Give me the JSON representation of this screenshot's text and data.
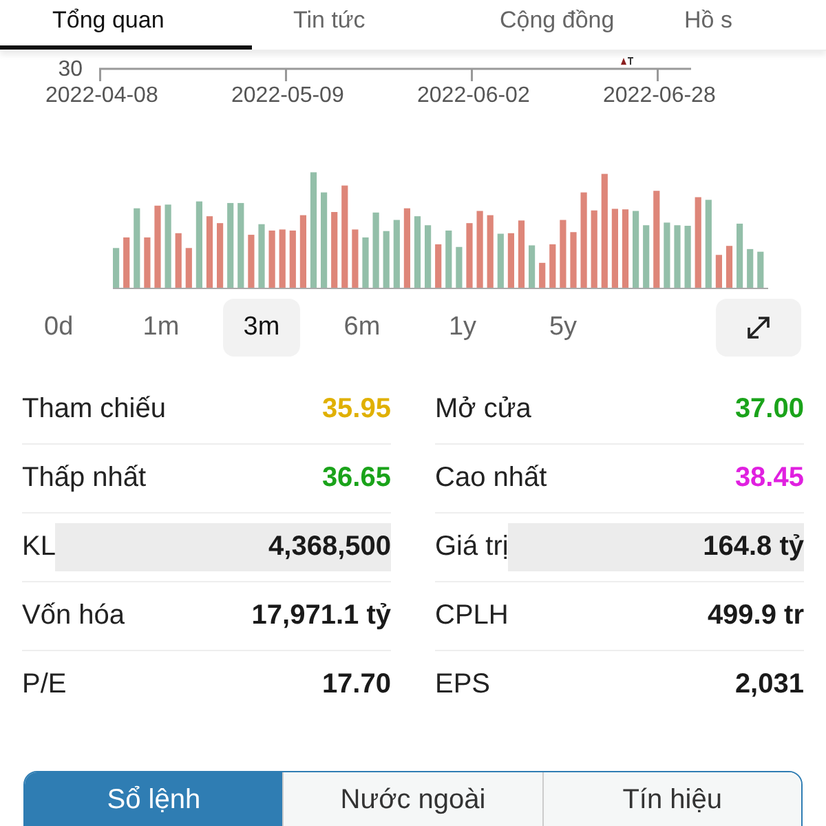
{
  "top_tabs": [
    {
      "label": "Tổng quan",
      "selected": true
    },
    {
      "label": "Tin tức",
      "selected": false
    },
    {
      "label": "Cộng đồng",
      "selected": false
    },
    {
      "label": "Hồ s",
      "selected": false
    }
  ],
  "price_axis": {
    "y_tick": "30",
    "dates": [
      "2022-04-08",
      "2022-05-09",
      "2022-06-02",
      "2022-06-28"
    ]
  },
  "volume_chart": {
    "kind": "picture"
  },
  "periods": [
    {
      "label": "0d",
      "selected": false
    },
    {
      "label": "1m",
      "selected": false
    },
    {
      "label": "3m",
      "selected": true
    },
    {
      "label": "6m",
      "selected": false
    },
    {
      "label": "1y",
      "selected": false
    },
    {
      "label": "5y",
      "selected": false
    }
  ],
  "stats": [
    [
      {
        "label": "Tham chiếu",
        "value": "35.95",
        "color": "#e0b000",
        "highlighted": false
      },
      {
        "label": "Mở cửa",
        "value": "37.00",
        "color": "#1aa31a",
        "highlighted": false
      }
    ],
    [
      {
        "label": "Thấp nhất",
        "value": "36.65",
        "color": "#1aa31a",
        "highlighted": false
      },
      {
        "label": "Cao nhất",
        "value": "38.45",
        "color": "#e020e0",
        "highlighted": false
      }
    ],
    [
      {
        "label": "KL",
        "value": "4,368,500",
        "color": "#1a1a1a",
        "highlighted": true
      },
      {
        "label": "Giá trị",
        "value": "164.8 tỷ",
        "color": "#1a1a1a",
        "highlighted": true
      }
    ],
    [
      {
        "label": "Vốn hóa",
        "value": "17,971.1 tỷ",
        "color": "#1a1a1a",
        "highlighted": false
      },
      {
        "label": "CPLH",
        "value": "499.9 tr",
        "color": "#1a1a1a",
        "highlighted": false
      }
    ],
    [
      {
        "label": "P/E",
        "value": "17.70",
        "color": "#1a1a1a",
        "highlighted": false
      },
      {
        "label": "EPS",
        "value": "2,031",
        "color": "#1a1a1a",
        "highlighted": false
      }
    ]
  ],
  "bottom_tabs": [
    {
      "label": "Sổ lệnh",
      "selected": true
    },
    {
      "label": "Nước ngoài",
      "selected": false
    },
    {
      "label": "Tín hiệu",
      "selected": false
    }
  ]
}
